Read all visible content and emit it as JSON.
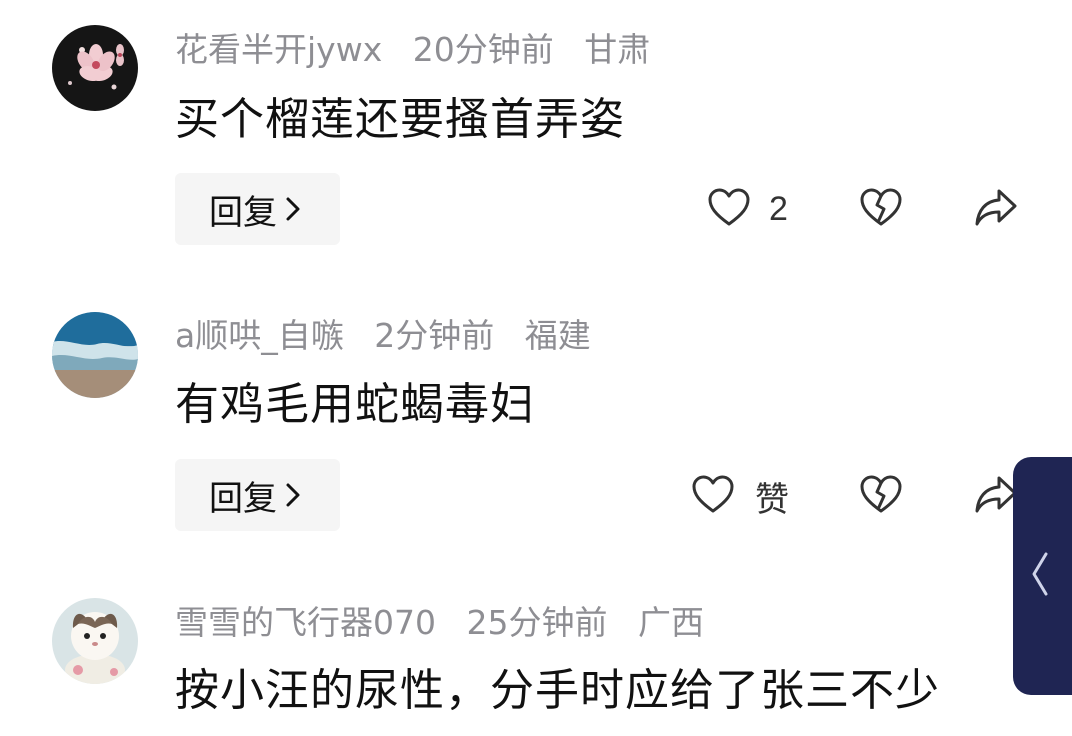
{
  "comments": [
    {
      "username": "花看半开jywx",
      "time": "20分钟前",
      "location": "甘肃",
      "text": "买个榴莲还要搔首弄姿",
      "reply_label": "回复",
      "like_label": "2"
    },
    {
      "username": "a顺哄_自嗾",
      "time": "2分钟前",
      "location": "福建",
      "text": "有鸡毛用蛇蝎毒妇",
      "reply_label": "回复",
      "like_label": "赞"
    },
    {
      "username": "雪雪的飞行器070",
      "time": "25分钟前",
      "location": "广西",
      "text": "按小汪的尿性，分手时应给了张三不少"
    }
  ],
  "icons": {
    "like": "heart-icon",
    "dislike": "broken-heart-icon",
    "share": "share-arrow-icon",
    "reply_chevron": "chevron-right-icon",
    "side_tab": "chevron-left-icon"
  },
  "colors": {
    "meta_text": "#8e8e93",
    "body_text": "#111111",
    "reply_bg": "#f5f5f5",
    "side_tab_bg": "#1f2553",
    "icon_stroke": "#333333"
  }
}
